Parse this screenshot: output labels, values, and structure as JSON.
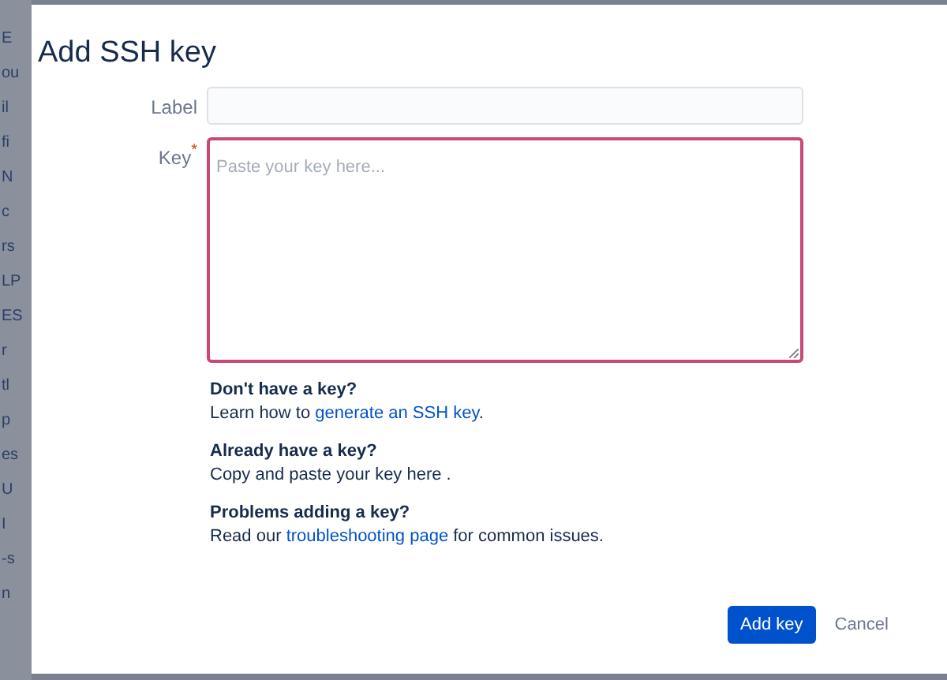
{
  "background_sidebar": [
    "E",
    "ou",
    "il",
    "fi",
    "N",
    "c",
    "rs",
    "LP",
    "ES",
    "r",
    "tl",
    "p",
    "es",
    "U",
    "I",
    "-s",
    "n"
  ],
  "dialog": {
    "title": "Add SSH key",
    "fields": [
      {
        "kind": "input",
        "label": "Label",
        "focused": false
      },
      {
        "kind": "textarea",
        "label": "Key",
        "required_mark": "*",
        "focused": true,
        "placeholder": "Paste your key here..."
      }
    ],
    "help": [
      {
        "heading": "Don't have a key?",
        "before": "Learn how to ",
        "link": "generate an SSH key",
        "after": "."
      },
      {
        "heading": "Already have a key?",
        "before": "Copy and paste your key here ."
      },
      {
        "heading": "Problems adding a key?",
        "before": "Read our ",
        "link": "troubleshooting page",
        "after": " for common issues."
      }
    ],
    "buttons": [
      {
        "kind": "primary",
        "label": "Add key"
      },
      {
        "kind": "link",
        "label": "Cancel"
      }
    ]
  }
}
